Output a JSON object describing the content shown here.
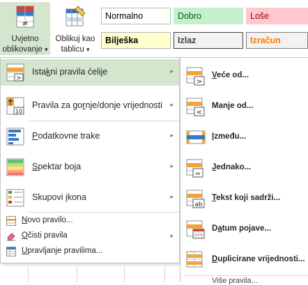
{
  "ribbon": {
    "conditional_formatting": {
      "line1": "Uvjetno",
      "line2": "oblikovanje",
      "arrow": "▾"
    },
    "format_as_table": {
      "line1": "Oblikuj kao",
      "line2": "tablicu",
      "arrow": "▾"
    },
    "styles": {
      "normal": "Normalno",
      "good": "Dobro",
      "bad": "Loše",
      "note": "Bilješka",
      "output": "Izlaz",
      "calculation": "Izračun"
    }
  },
  "menu": {
    "items": [
      {
        "pre": "Ista",
        "key": "k",
        "post": "ni pravila ćelije",
        "arrow": "▸",
        "icon": "highlight-cells-rules-icon"
      },
      {
        "pre": "Pravila za go",
        "key": "r",
        "post": "nje/donje vrijednosti",
        "arrow": "▸",
        "icon": "top-bottom-rules-icon"
      },
      {
        "pre": "",
        "key": "P",
        "post": "odatkovne trake",
        "arrow": "▸",
        "icon": "data-bars-icon"
      },
      {
        "pre": "",
        "key": "S",
        "post": "pektar boja",
        "arrow": "▸",
        "icon": "color-scales-icon"
      },
      {
        "pre": "Skupovi ",
        "key": "i",
        "post": "kona",
        "arrow": "▸",
        "icon": "icon-sets-icon"
      }
    ],
    "small_items": [
      {
        "pre": "",
        "key": "N",
        "post": "ovo pravilo...",
        "arrow": "",
        "icon": "new-rule-icon"
      },
      {
        "pre": "",
        "key": "O",
        "post": "čisti pravila",
        "arrow": "▸",
        "icon": "clear-rules-icon"
      },
      {
        "pre": "",
        "key": "U",
        "post": "pravljanje pravilima...",
        "arrow": "",
        "icon": "manage-rules-icon"
      }
    ]
  },
  "submenu": {
    "items": [
      {
        "pre": "",
        "key": "V",
        "post": "eće od...",
        "icon": "greater-than-icon"
      },
      {
        "pre": "Man",
        "key": "j",
        "post": "e od...",
        "icon": "less-than-icon"
      },
      {
        "pre": "",
        "key": "I",
        "post": "zmeđu...",
        "icon": "between-icon"
      },
      {
        "pre": "",
        "key": "J",
        "post": "ednako...",
        "icon": "equal-to-icon"
      },
      {
        "pre": "",
        "key": "T",
        "post": "ekst koji sadrži...",
        "icon": "text-contains-icon"
      },
      {
        "pre": "D",
        "key": "a",
        "post": "tum pojave...",
        "icon": "date-occurring-icon"
      },
      {
        "pre": "",
        "key": "D",
        "post": "uplicirane vrijednosti...",
        "icon": "duplicate-values-icon"
      }
    ],
    "more_rules": "Više pravila..."
  },
  "colors": {
    "highlight": "#d5e6cf",
    "accent_green": "#217346"
  }
}
